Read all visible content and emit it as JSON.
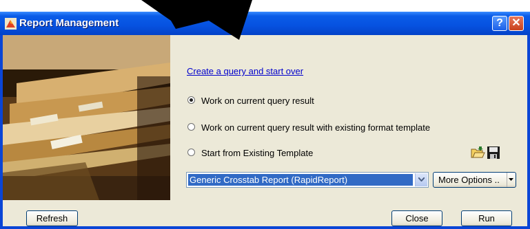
{
  "window": {
    "title": "Report Management"
  },
  "main": {
    "create_link": "Create a query and start over",
    "options": [
      {
        "label": "Work on current query result",
        "checked": true
      },
      {
        "label": "Work on current query result with existing format template",
        "checked": false
      },
      {
        "label": "Start from Existing Template",
        "checked": false
      }
    ],
    "template_select": {
      "value": "Generic Crosstab Report (RapidReport)"
    },
    "more_options_label": "More Options .."
  },
  "buttons": {
    "refresh": "Refresh",
    "close": "Close",
    "run": "Run"
  },
  "icons": {
    "open": "open-folder-icon",
    "save": "floppy-save-icon"
  }
}
